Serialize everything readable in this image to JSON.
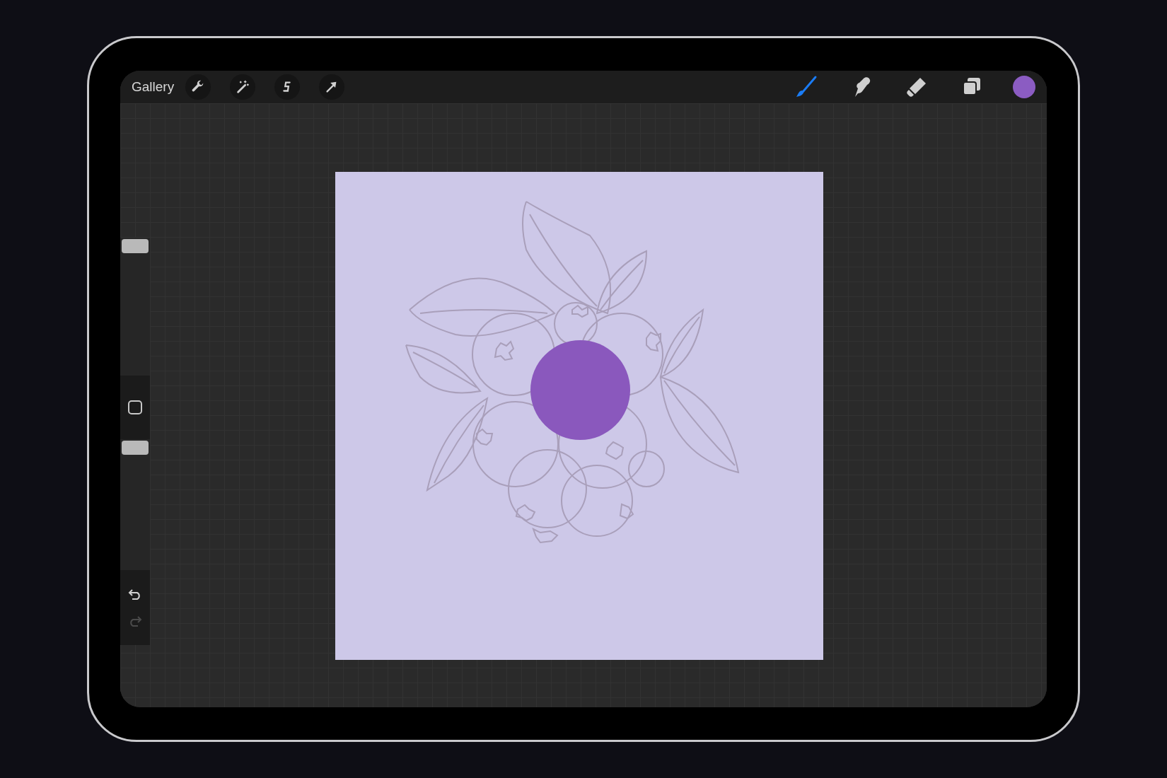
{
  "toolbar": {
    "gallery": "Gallery",
    "actions": [
      {
        "kind": "wrench"
      },
      {
        "kind": "magic"
      },
      {
        "kind": "selection"
      },
      {
        "kind": "transform"
      }
    ],
    "tools": [
      {
        "kind": "brush",
        "selected": true
      },
      {
        "kind": "smudge",
        "selected": false
      },
      {
        "kind": "eraser",
        "selected": false
      },
      {
        "kind": "layers",
        "selected": false
      }
    ],
    "current_color": {
      "color": "#8b5cc2"
    }
  },
  "sidebar": {
    "size_slider": {
      "level": 1
    },
    "opacity_slider": {
      "level": 1
    },
    "undo": {
      "disabled": false
    },
    "redo": {
      "disabled": true
    }
  }
}
